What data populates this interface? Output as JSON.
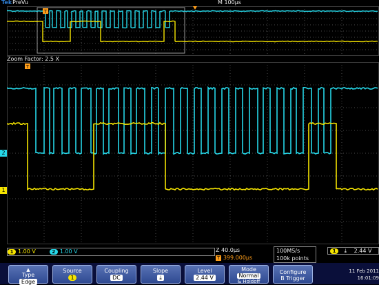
{
  "header": {
    "brand_tek": "Tek",
    "brand_mode": "PreVu",
    "timebase": "M 100µs"
  },
  "zoom": {
    "label": "Zoom Factor: 2.5 X"
  },
  "markers": {
    "trigger": "T",
    "ch1": "1",
    "ch2": "2"
  },
  "readouts": {
    "ch1_scale": "1.00 V",
    "ch2_scale": "1.00 V",
    "ch1_chip": "1",
    "ch2_chip": "2",
    "zoom_time": "Z 40.0µs",
    "zoom_pos": "399.000µs",
    "zoom_pos_icon": "T",
    "sample_rate": "100MS/s",
    "record_length": "100k points",
    "trig_chip": "1",
    "trig_level": "2.44 V"
  },
  "menu": {
    "type": {
      "label": "Type",
      "value": "Edge"
    },
    "source": {
      "label": "Source",
      "value": "1"
    },
    "coupling": {
      "label": "Coupling",
      "value": "DC"
    },
    "slope": {
      "label": "Slope",
      "value": "⤓"
    },
    "level": {
      "label": "Level",
      "value": "2.44 V"
    },
    "mode": {
      "label": "Mode",
      "value1": "Normal",
      "value2": "& Holdoff"
    },
    "configure": {
      "label1": "Configure",
      "label2": "B Trigger"
    }
  },
  "datetime": {
    "date": "11 Feb 2011",
    "time": "16:01:09"
  },
  "colors": {
    "ch1": "#f5e400",
    "ch2": "#26d7e8",
    "accent": "#ff9e1a",
    "grid": "#4a4a4a"
  }
}
